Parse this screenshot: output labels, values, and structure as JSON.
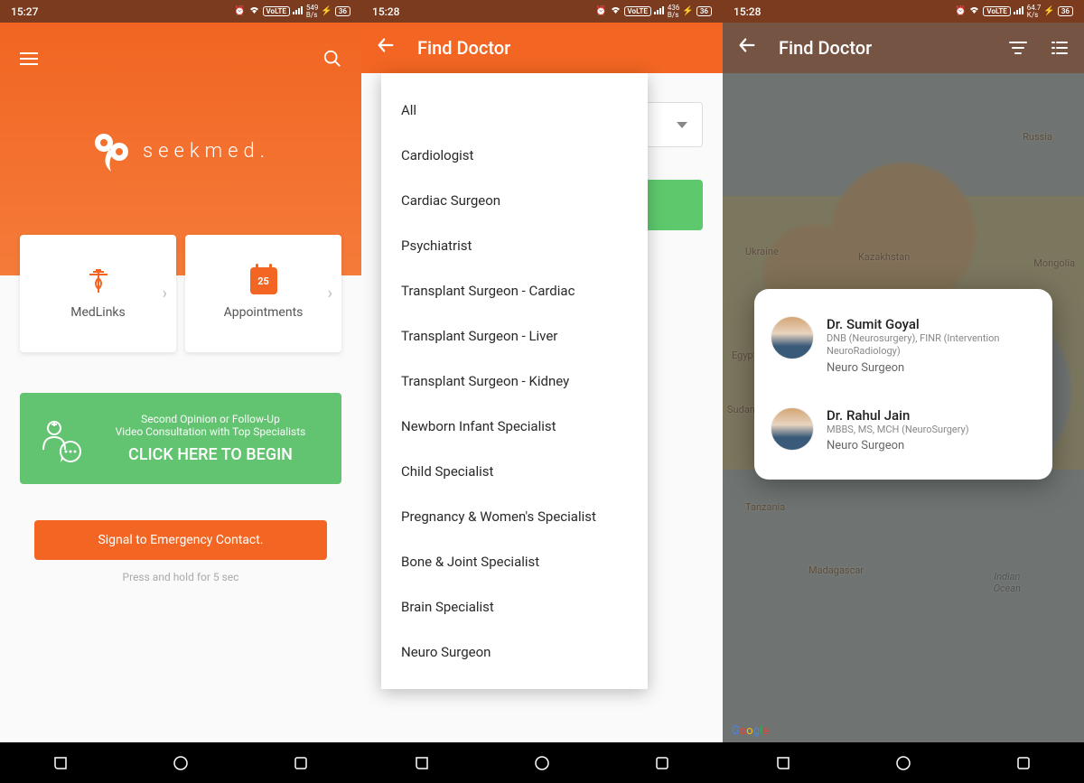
{
  "screens": {
    "s1": {
      "status": {
        "time": "15:27",
        "net": "549",
        "net_unit": "B/s",
        "battery": "36",
        "volte": "VoLTE"
      },
      "logo_text": "seekmed.",
      "cards": [
        {
          "label": "MedLinks",
          "icon": "medical"
        },
        {
          "label": "Appointments",
          "icon": "calendar",
          "cal_num": "25"
        }
      ],
      "green": {
        "line1": "Second Opinion or Follow-Up",
        "line2": "Video Consultation with Top Specialists",
        "cta": "CLICK HERE TO BEGIN"
      },
      "emergency": "Signal to Emergency Contact.",
      "hold_hint": "Press and hold for 5 sec"
    },
    "s2": {
      "status": {
        "time": "15:28",
        "net": "436",
        "net_unit": "B/s",
        "battery": "36",
        "volte": "VoLTE"
      },
      "title": "Find Doctor",
      "menu": [
        "All",
        "Cardiologist",
        "Cardiac Surgeon",
        "Psychiatrist",
        "Transplant Surgeon - Cardiac",
        "Transplant Surgeon - Liver",
        "Transplant Surgeon - Kidney",
        "Newborn Infant Specialist",
        "Child Specialist",
        "Pregnancy & Women's Specialist",
        "Bone & Joint Specialist",
        "Brain Specialist",
        "Neuro Surgeon"
      ]
    },
    "s3": {
      "status": {
        "time": "15:28",
        "net": "64.7",
        "net_unit": "K/s",
        "battery": "36",
        "volte": "VoLTE"
      },
      "title": "Find Doctor",
      "map_labels": {
        "russia": "Russia",
        "ukraine": "Ukraine",
        "kazakhstan": "Kazakhstan",
        "mongolia": "Mongolia",
        "egypt": "Egypt",
        "sudan": "Sudan",
        "tanzania": "Tanzania",
        "madagascar": "Madagascar",
        "indian_ocean": "Indian\nOcean"
      },
      "google": "Google",
      "doctors": [
        {
          "name": "Dr. Sumit Goyal",
          "creds": "DNB (Neurosurgery), FINR (Intervention NeuroRadiology)",
          "spec": "Neuro Surgeon"
        },
        {
          "name": "Dr. Rahul Jain",
          "creds": "MBBS, MS, MCH (NeuroSurgery)",
          "spec": "Neuro Surgeon"
        }
      ]
    }
  }
}
